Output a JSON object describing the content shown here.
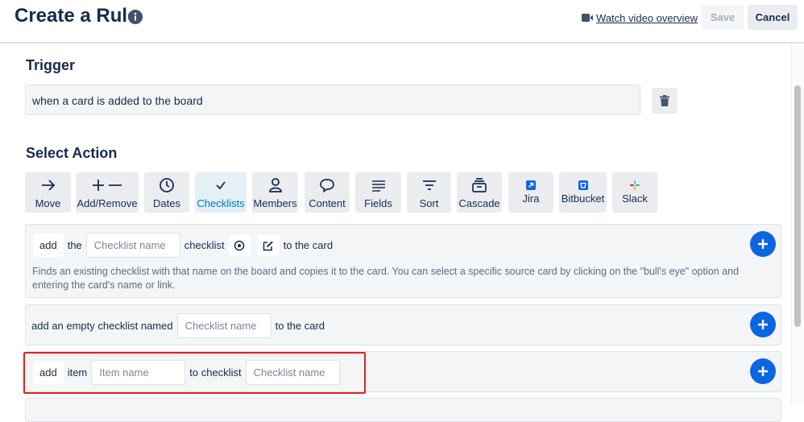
{
  "header": {
    "title": "Create a Rule",
    "watch_label": "Watch video overview",
    "save_label": "Save",
    "cancel_label": "Cancel"
  },
  "trigger": {
    "heading": "Trigger",
    "value": "when a card is added to the board"
  },
  "action": {
    "heading": "Select Action",
    "tabs": [
      {
        "label": "Move",
        "icon": "arrow-right-icon"
      },
      {
        "label": "Add/Remove",
        "icon": "plus-minus-icon"
      },
      {
        "label": "Dates",
        "icon": "clock-icon"
      },
      {
        "label": "Checklists",
        "icon": "check-icon",
        "active": true
      },
      {
        "label": "Members",
        "icon": "person-icon"
      },
      {
        "label": "Content",
        "icon": "speech-bubble-icon"
      },
      {
        "label": "Fields",
        "icon": "lines-icon"
      },
      {
        "label": "Sort",
        "icon": "sort-icon"
      },
      {
        "label": "Cascade",
        "icon": "stack-icon"
      },
      {
        "label": "Jira",
        "icon": "jira-logo-icon"
      },
      {
        "label": "Bitbucket",
        "icon": "bitbucket-logo-icon"
      },
      {
        "label": "Slack",
        "icon": "slack-logo-icon"
      }
    ]
  },
  "cards": {
    "copy_checklist": {
      "add": "add",
      "the": "the",
      "placeholder": "Checklist name",
      "checklist": "checklist",
      "to_the_card": "to the card",
      "description": "Finds an existing checklist with that name on the board and copies it to the card. You can select a specific source card by clicking on the \"bull's eye\" option and entering the card's name or link."
    },
    "empty_checklist": {
      "prefix": "add an empty checklist named",
      "placeholder": "Checklist name",
      "suffix": "to the card"
    },
    "add_item": {
      "add": "add",
      "item": "item",
      "item_placeholder": "Item name",
      "to_checklist": "to checklist",
      "checklist_placeholder": "Checklist name"
    }
  },
  "colors": {
    "accent_blue": "#0c66e4",
    "active_tab_text": "#0079bf",
    "highlight_red": "#e2231a"
  }
}
